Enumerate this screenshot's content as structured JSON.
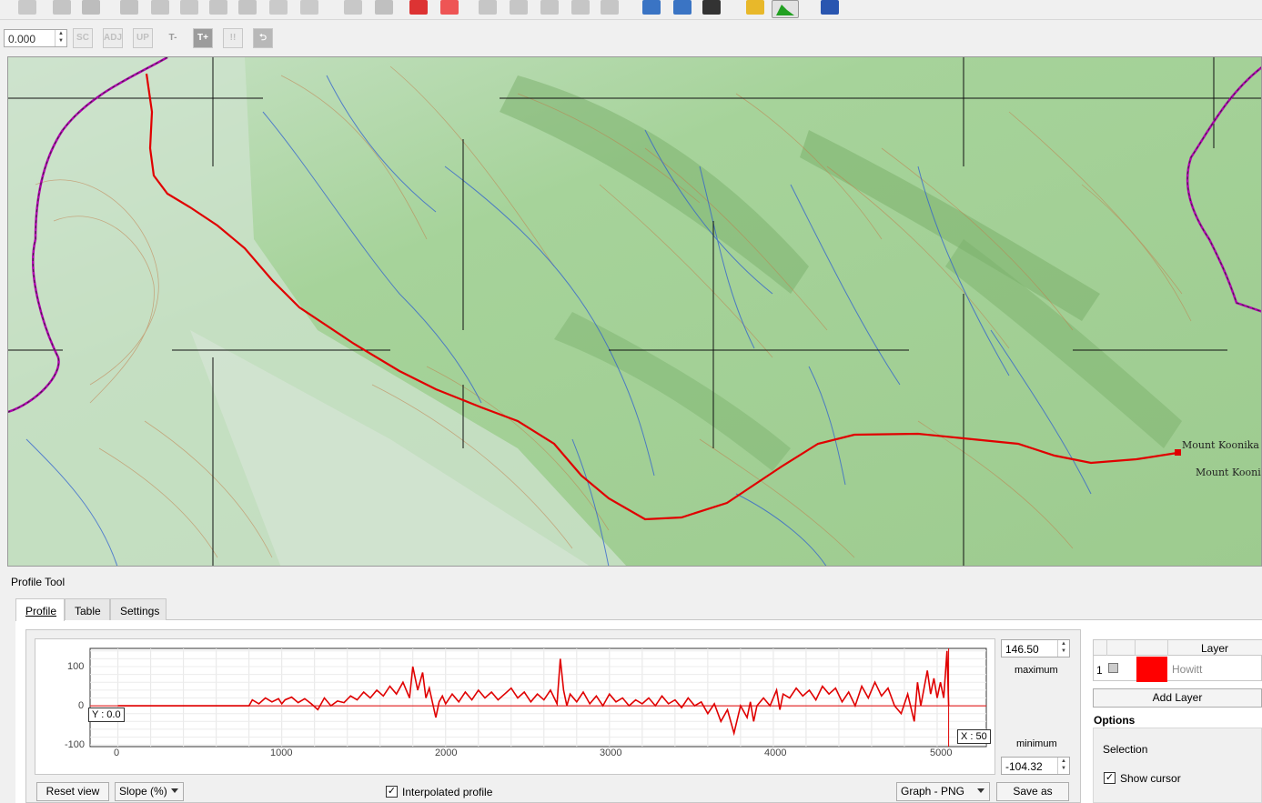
{
  "toolbar2": {
    "spin_value": "0.000",
    "buttons": [
      "SC",
      "ADJ",
      "UP",
      "T-",
      "T+",
      "!!"
    ]
  },
  "panel": {
    "title": "Profile Tool",
    "tabs": [
      "Profile",
      "Table",
      "Settings"
    ]
  },
  "plot": {
    "max_value": "146.50",
    "max_label": "maximum",
    "min_label": "minimum",
    "min_value": "-104.32",
    "y_cursor": "Y : 0.0",
    "x_cursor": "X : 50",
    "y_ticks": [
      "100",
      "0",
      "-100"
    ],
    "x_ticks": [
      "0",
      "1000",
      "2000",
      "3000",
      "4000",
      "5000"
    ]
  },
  "controls": {
    "reset_view": "Reset view",
    "plot_mode": "Slope (%)",
    "interpolated_label": "Interpolated profile",
    "interpolated_checked": "✓",
    "export_format": "Graph - PNG",
    "save_as": "Save as"
  },
  "layers": {
    "header": "Layer",
    "rows": [
      {
        "index": "1",
        "name": "Howitt",
        "color": "#ff0000"
      }
    ],
    "add_layer": "Add Layer"
  },
  "options": {
    "title": "Options",
    "selection_label": "Selection",
    "show_cursor_label": "Show cursor",
    "show_cursor_checked": "✓"
  },
  "map_labels": [
    "Mount Koonika",
    "Mount Koonika"
  ],
  "chart_data": {
    "type": "line",
    "title": "",
    "xlabel": "",
    "ylabel": "",
    "xlim": [
      -170,
      5300
    ],
    "ylim": [
      -104.32,
      146.5
    ],
    "series": [
      {
        "color": "#e00000",
        "x": [
          0,
          800,
          820,
          860,
          900,
          940,
          980,
          1000,
          1020,
          1060,
          1100,
          1140,
          1180,
          1220,
          1260,
          1300,
          1340,
          1380,
          1420,
          1460,
          1500,
          1540,
          1580,
          1620,
          1660,
          1700,
          1740,
          1780,
          1800,
          1830,
          1860,
          1880,
          1900,
          1940,
          1960,
          1980,
          2000,
          2040,
          2080,
          2120,
          2160,
          2200,
          2240,
          2280,
          2320,
          2360,
          2400,
          2440,
          2480,
          2520,
          2560,
          2600,
          2640,
          2680,
          2700,
          2720,
          2740,
          2760,
          2800,
          2840,
          2880,
          2920,
          2960,
          3000,
          3040,
          3080,
          3120,
          3160,
          3200,
          3240,
          3280,
          3320,
          3360,
          3400,
          3440,
          3480,
          3520,
          3560,
          3600,
          3640,
          3680,
          3720,
          3760,
          3800,
          3840,
          3860,
          3880,
          3900,
          3940,
          3980,
          4020,
          4040,
          4060,
          4100,
          4140,
          4180,
          4220,
          4260,
          4300,
          4340,
          4380,
          4420,
          4460,
          4500,
          4540,
          4580,
          4620,
          4660,
          4700,
          4740,
          4780,
          4820,
          4860,
          4880,
          4900,
          4940,
          4960,
          4980,
          5000,
          5020,
          5040,
          5060,
          5070,
          5070
        ],
        "y": [
          0,
          0,
          15,
          5,
          20,
          10,
          18,
          5,
          15,
          22,
          8,
          18,
          5,
          -10,
          20,
          0,
          12,
          8,
          25,
          15,
          35,
          20,
          40,
          25,
          50,
          30,
          60,
          20,
          100,
          40,
          85,
          20,
          45,
          -30,
          10,
          25,
          5,
          30,
          10,
          35,
          15,
          40,
          20,
          35,
          15,
          30,
          45,
          20,
          35,
          10,
          30,
          15,
          40,
          5,
          120,
          40,
          0,
          30,
          10,
          35,
          5,
          25,
          0,
          30,
          10,
          20,
          0,
          15,
          5,
          20,
          0,
          25,
          5,
          15,
          -5,
          20,
          0,
          10,
          -20,
          5,
          -40,
          -10,
          -70,
          0,
          -30,
          10,
          -40,
          0,
          20,
          0,
          40,
          -10,
          30,
          20,
          45,
          25,
          40,
          15,
          50,
          30,
          45,
          10,
          35,
          0,
          50,
          20,
          60,
          25,
          45,
          0,
          -20,
          30,
          -40,
          60,
          0,
          90,
          30,
          70,
          20,
          60,
          20,
          140,
          0,
          0
        ]
      }
    ]
  }
}
